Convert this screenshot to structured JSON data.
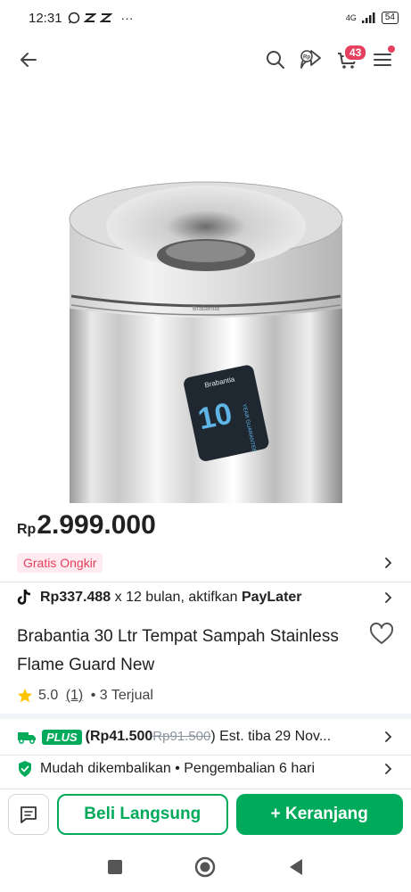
{
  "status_bar": {
    "time": "12:31",
    "network": "4G",
    "battery": "54"
  },
  "header": {
    "cart_count": "43"
  },
  "product": {
    "price_currency": "Rp",
    "price_amount": "2.999.000",
    "shipping_badge": "Gratis Ongkir",
    "paylater": {
      "amount": "Rp337.488",
      "text": " x 12 bulan, aktifkan ",
      "brand": "PayLater"
    },
    "title": "Brabantia 30 Ltr Tempat Sampah Stainless Flame Guard New",
    "rating": "5.0",
    "review_count": "(1)",
    "sold": "• 3 Terjual",
    "image_brand": "Brabantia",
    "tag_number": "10",
    "tag_text": "YEAR GUARANTEE"
  },
  "shipping": {
    "plus_label": "PLUS",
    "price_open": "(Rp41.500",
    "price_old": "Rp91.500",
    "price_close": ")",
    "eta": " Est. tiba 29 Nov..."
  },
  "returns": {
    "label": "Mudah dikembalikan",
    "detail": " • Pengembalian 6 hari"
  },
  "actions": {
    "buy_now": "Beli Langsung",
    "add_cart": "+ Keranjang"
  },
  "colors": {
    "primary": "#00aa5b",
    "badge": "#e5405e",
    "star": "#ffc400"
  }
}
